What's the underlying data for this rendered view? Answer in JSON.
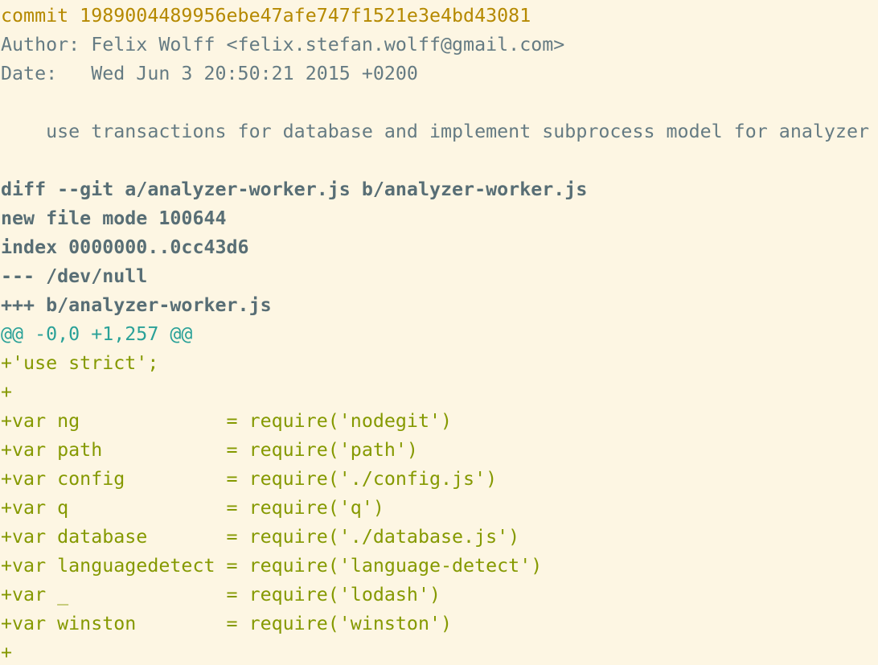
{
  "colors": {
    "background": "#fdf6e3",
    "commit": "#b58900",
    "meta": "#657b83",
    "diff_header": "#586e75",
    "hunk": "#2aa198",
    "added": "#859900"
  },
  "commit_line": "commit 1989004489956ebe47afe747f1521e3e4bd43081",
  "author_line": "Author: Felix Wolff <felix.stefan.wolff@gmail.com>",
  "date_line": "Date:   Wed Jun 3 20:50:21 2015 +0200",
  "blank": "",
  "message_line": "    use transactions for database and implement subprocess model for analyzer",
  "diff_header": [
    "diff --git a/analyzer-worker.js b/analyzer-worker.js",
    "new file mode 100644",
    "index 0000000..0cc43d6",
    "--- /dev/null",
    "+++ b/analyzer-worker.js"
  ],
  "hunk_header": "@@ -0,0 +1,257 @@",
  "added_lines": [
    "+'use strict';",
    "+",
    "+var ng             = require('nodegit')",
    "+var path           = require('path')",
    "+var config         = require('./config.js')",
    "+var q              = require('q')",
    "+var database       = require('./database.js')",
    "+var languagedetect = require('language-detect')",
    "+var _              = require('lodash')",
    "+var winston        = require('winston')",
    "+"
  ]
}
